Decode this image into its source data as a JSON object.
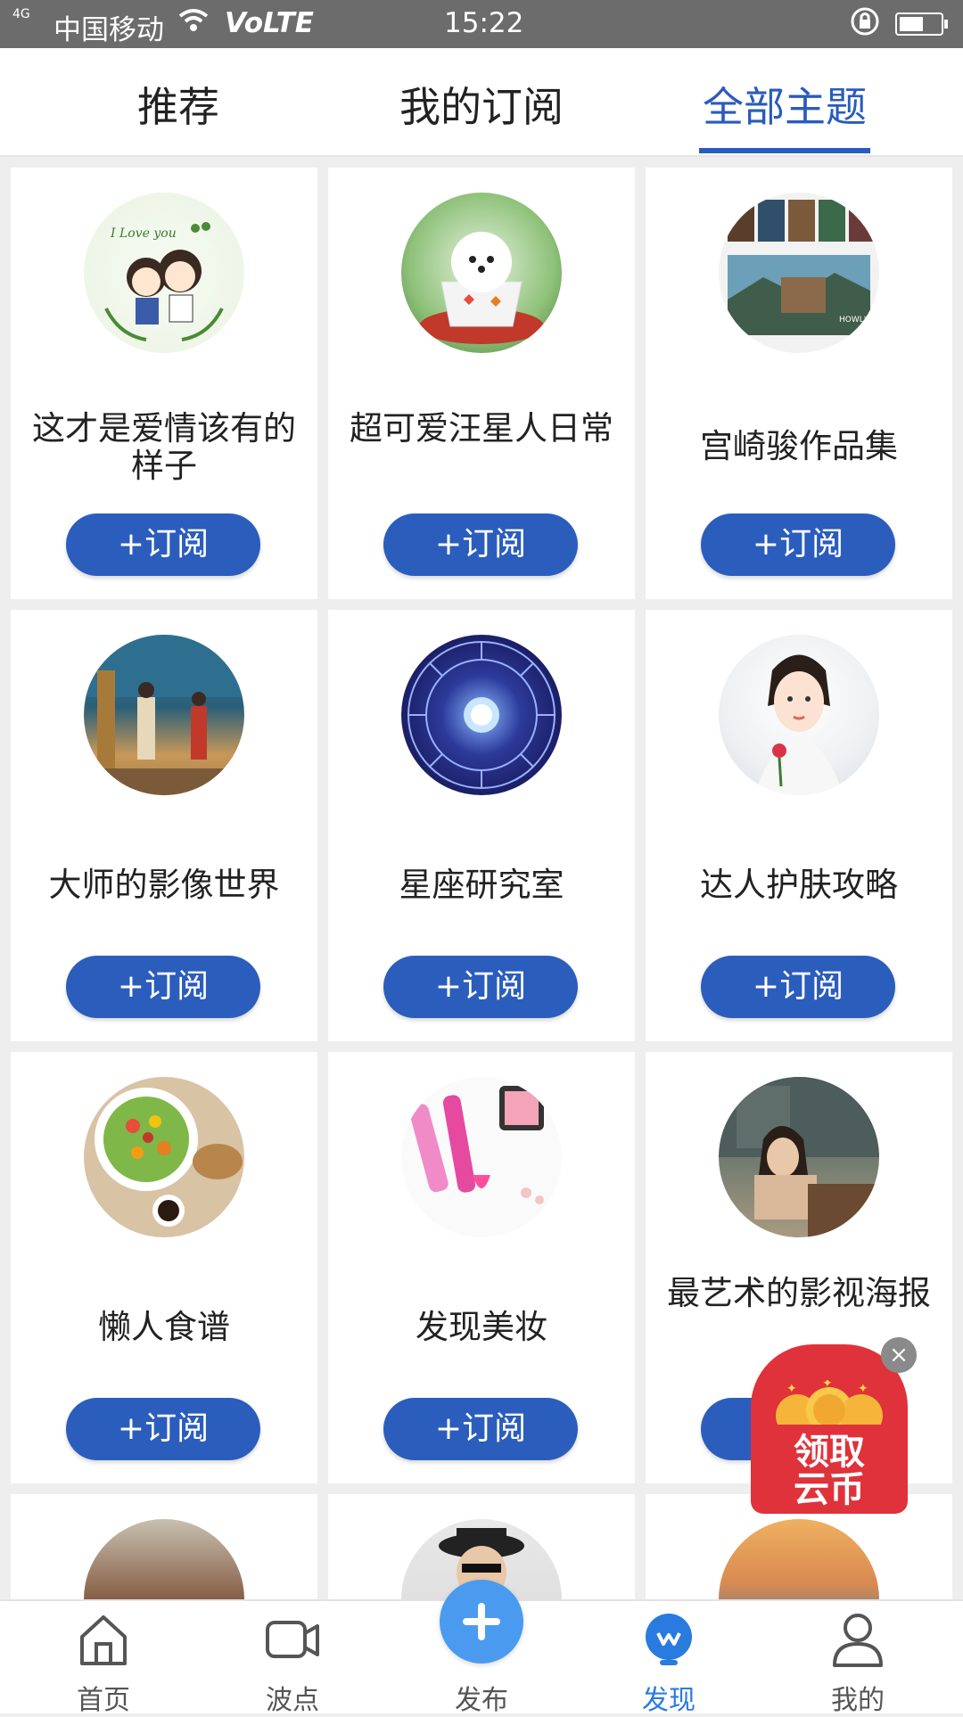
{
  "status_bar": {
    "signal": "4G",
    "carrier": "中国移动",
    "network": "VoLTE",
    "time": "15:22",
    "battery_level": 0.6
  },
  "tabs": [
    {
      "label": "推荐",
      "active": false
    },
    {
      "label": "我的订阅",
      "active": false
    },
    {
      "label": "全部主题",
      "active": true
    }
  ],
  "topics": [
    {
      "title": "这才是爱情该有的样子",
      "button": "+订阅"
    },
    {
      "title": "超可爱汪星人日常",
      "button": "+订阅"
    },
    {
      "title": "宫崎骏作品集",
      "button": "+订阅"
    },
    {
      "title": "大师的影像世界",
      "button": "+订阅"
    },
    {
      "title": "星座研究室",
      "button": "+订阅"
    },
    {
      "title": "达人护肤攻略",
      "button": "+订阅"
    },
    {
      "title": "懒人食谱",
      "button": "+订阅"
    },
    {
      "title": "发现美妆",
      "button": "+订阅"
    },
    {
      "title": "最艺术的影视海报",
      "button": "+订阅"
    }
  ],
  "bottom_nav": [
    {
      "label": "首页",
      "icon": "home-icon"
    },
    {
      "label": "波点",
      "icon": "video-camera-icon"
    },
    {
      "label": "发布",
      "icon": "plus-icon"
    },
    {
      "label": "发现",
      "icon": "discover-bulb-icon",
      "active": true
    },
    {
      "label": "我的",
      "icon": "person-icon"
    }
  ],
  "promo": {
    "text_line1": "领取",
    "text_line2": "云币",
    "close_symbol": "×"
  },
  "colors": {
    "accent": "#2a5bbe",
    "button": "#2b5dbd",
    "nav_active": "#2a7be0",
    "promo_red": "#e0323a"
  }
}
